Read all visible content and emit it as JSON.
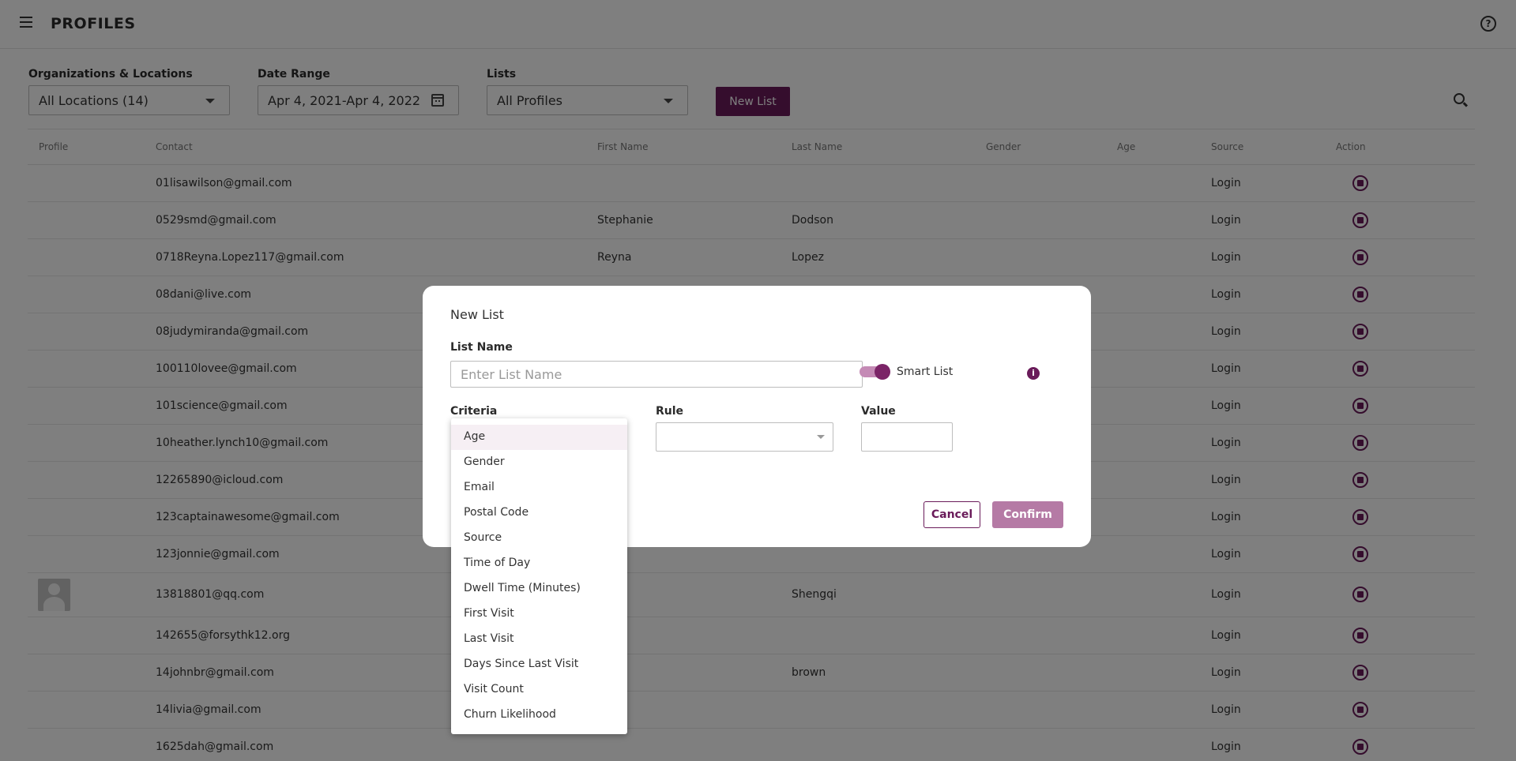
{
  "header": {
    "title": "PROFILES"
  },
  "filters": {
    "org_label": "Organizations & Locations",
    "org_value": "All Locations (14)",
    "date_label": "Date Range",
    "date_value": "Apr 4, 2021-Apr 4, 2022",
    "lists_label": "Lists",
    "lists_value": "All Profiles",
    "new_list_button": "New List"
  },
  "table": {
    "columns": [
      "Profile",
      "Contact",
      "First Name",
      "Last Name",
      "Gender",
      "Age",
      "Source",
      "Action"
    ],
    "rows": [
      {
        "contact": "01lisawilson@gmail.com",
        "first": "",
        "last": "",
        "source": "Login"
      },
      {
        "contact": "0529smd@gmail.com",
        "first": "Stephanie",
        "last": "Dodson",
        "source": "Login"
      },
      {
        "contact": "0718Reyna.Lopez117@gmail.com",
        "first": "Reyna",
        "last": "Lopez",
        "source": "Login"
      },
      {
        "contact": "08dani@live.com",
        "first": "",
        "last": "",
        "source": "Login"
      },
      {
        "contact": "08judymiranda@gmail.com",
        "first": "",
        "last": "",
        "source": "Login"
      },
      {
        "contact": "100110lovee@gmail.com",
        "first": "",
        "last": "",
        "source": "Login"
      },
      {
        "contact": "101science@gmail.com",
        "first": "",
        "last": "",
        "source": "Login"
      },
      {
        "contact": "10heather.lynch10@gmail.com",
        "first": "",
        "last": "",
        "source": "Login"
      },
      {
        "contact": "12265890@icloud.com",
        "first": "",
        "last": "",
        "source": "Login"
      },
      {
        "contact": "123captainawesome@gmail.com",
        "first": "",
        "last": "",
        "source": "Login"
      },
      {
        "contact": "123jonnie@gmail.com",
        "first": "",
        "last": "",
        "source": "Login"
      },
      {
        "contact": "13818801@qq.com",
        "first": "",
        "last": "Shengqi",
        "source": "Login"
      },
      {
        "contact": "142655@forsythk12.org",
        "first": "",
        "last": "",
        "source": "Login"
      },
      {
        "contact": "14johnbr@gmail.com",
        "first": "",
        "last": "brown",
        "source": "Login"
      },
      {
        "contact": "14livia@gmail.com",
        "first": "",
        "last": "",
        "source": "Login"
      },
      {
        "contact": "1625dah@gmail.com",
        "first": "",
        "last": "",
        "source": "Login"
      }
    ]
  },
  "modal": {
    "title": "New List",
    "list_name_label": "List Name",
    "list_name_placeholder": "Enter List Name",
    "smart_list_label": "Smart List",
    "info_glyph": "i",
    "criteria_label": "Criteria",
    "rule_label": "Rule",
    "value_label": "Value",
    "cancel_button": "Cancel",
    "confirm_button": "Confirm"
  },
  "criteria_options": [
    "Age",
    "Gender",
    "Email",
    "Postal Code",
    "Source",
    "Time of Day",
    "Dwell Time (Minutes)",
    "First Visit",
    "Last Visit",
    "Days Since Last Visit",
    "Visit Count",
    "Churn Likelihood"
  ],
  "help_glyph": "?",
  "colors": {
    "brand": "#6a1b5a",
    "confirm": "#b57aa5",
    "toggle_track": "#c48ab5"
  },
  "icons": [
    "menu-icon",
    "help-icon",
    "caret-down-icon",
    "calendar-icon",
    "search-icon",
    "stop-circle-icon",
    "info-icon",
    "avatar-placeholder-icon"
  ]
}
